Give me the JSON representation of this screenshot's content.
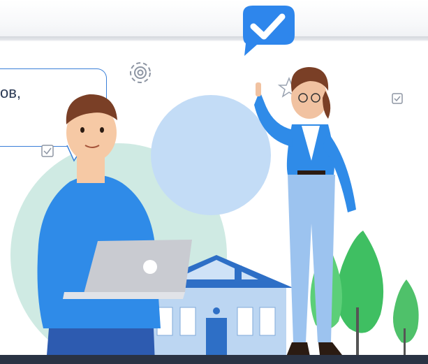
{
  "speech": {
    "text": "ов,"
  },
  "icons": [
    "check-badge-icon",
    "gear-icon",
    "star-outline-icon",
    "checkbox-icon"
  ],
  "colors": {
    "accent": "#2b7de9",
    "shirt": "#2f8be8",
    "circle": "#bcd9f5",
    "mint": "#cde9e2",
    "tree": "#4fc16a"
  }
}
